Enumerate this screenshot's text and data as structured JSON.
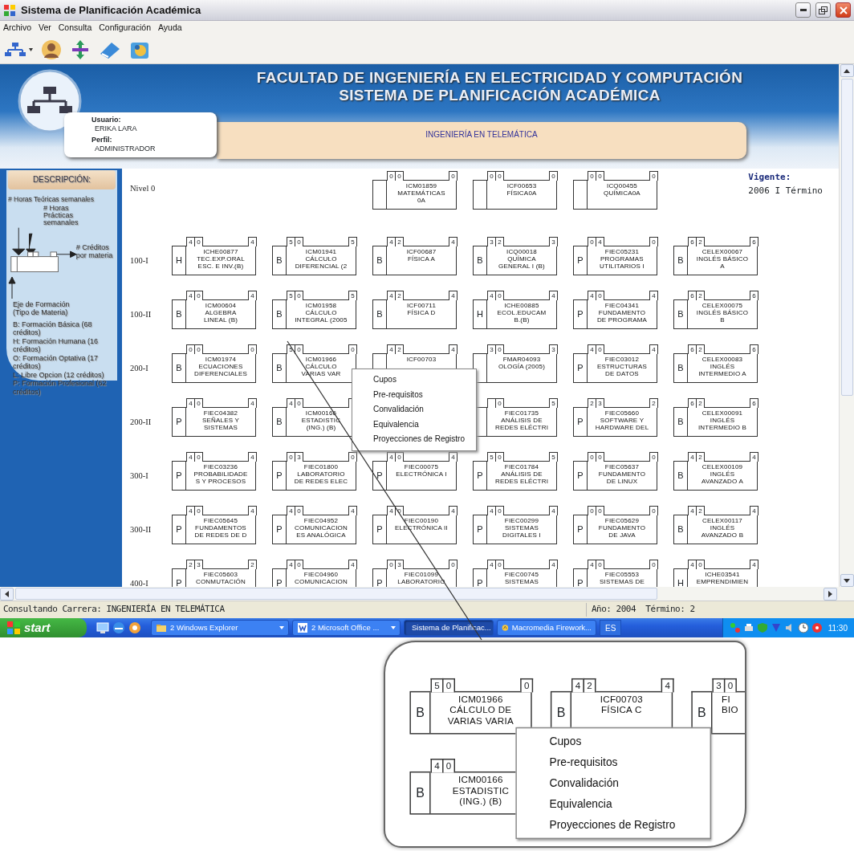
{
  "window": {
    "title": "Sistema de Planificación Académica"
  },
  "menu": [
    "Archivo",
    "Ver",
    "Consulta",
    "Configuración",
    "Ayuda"
  ],
  "header": {
    "faculty": "FACULTAD DE INGENIERÍA EN ELECTRICIDAD Y COMPUTACIÓN",
    "system": "SISTEMA DE PLANIFICACIÓN ACADÉMICA",
    "user_label": "Usuario:",
    "user": "ERIKA LARA",
    "profile_label": "Perfil:",
    "profile": "ADMINISTRADOR",
    "career": "INGENIERÍA EN TELEMÁTICA",
    "valid_label": "Vigente:",
    "valid": "2006 I Término"
  },
  "legend": {
    "title": "DESCRIPCIÓN:",
    "theory": "# Horas Teóricas semanales",
    "practice": "# Horas Prácticas semanales",
    "credits": "# Créditos por materia",
    "axis": "Eje de Formación (Tipo de Materia)",
    "types": [
      "B: Formación Básica (68 créditos)",
      "H: Formación Humana (16 créditos)",
      "O: Formación Optativa (17 créditos)",
      "L: Libre Opcion (12 créditos)",
      "P: Formación Profesional (62 créditos)"
    ]
  },
  "levels": [
    {
      "label": "Nivel 0",
      "courses": [
        {
          "kind": "blank"
        },
        {
          "kind": "blank"
        },
        {
          "kind": "course",
          "t": "0",
          "p": "0",
          "c": "0",
          "code": "ICM01859",
          "name": [
            "MATEMÁTICAS",
            "0A"
          ]
        },
        {
          "kind": "course",
          "t": "0",
          "p": "0",
          "c": "0",
          "code": "ICF00653",
          "name": [
            "FÍSICA0A"
          ]
        },
        {
          "kind": "course",
          "t": "0",
          "p": "0",
          "c": "0",
          "code": "ICQ00455",
          "name": [
            "QUÍMICA0A"
          ]
        }
      ]
    },
    {
      "label": "100-I",
      "courses": [
        {
          "kind": "course",
          "type": "H",
          "t": "4",
          "p": "0",
          "c": "4",
          "code": "ICHE00877",
          "name": [
            "TEC.EXP.ORAL",
            "ESC. E INV.(B)"
          ]
        },
        {
          "kind": "course",
          "type": "B",
          "t": "5",
          "p": "0",
          "c": "5",
          "code": "ICM01941",
          "name": [
            "CÁLCULO",
            "DIFERENCIAL (2"
          ]
        },
        {
          "kind": "course",
          "type": "B",
          "t": "4",
          "p": "2",
          "c": "4",
          "code": "ICF00687",
          "name": [
            "FÍSICA A"
          ]
        },
        {
          "kind": "course",
          "type": "B",
          "t": "3",
          "p": "2",
          "c": "3",
          "code": "ICQ00018",
          "name": [
            "QUÍMICA",
            "GENERAL I (B)"
          ]
        },
        {
          "kind": "course",
          "type": "P",
          "t": "0",
          "p": "4",
          "c": "0",
          "code": "FIEC05231",
          "name": [
            "PROGRAMAS",
            "UTILITARIOS I"
          ]
        },
        {
          "kind": "course",
          "type": "B",
          "t": "6",
          "p": "2",
          "c": "6",
          "code": "CELEX00067",
          "name": [
            "INGLÉS BÁSICO",
            "A"
          ]
        }
      ]
    },
    {
      "label": "100-II",
      "courses": [
        {
          "kind": "course",
          "type": "B",
          "t": "4",
          "p": "0",
          "c": "4",
          "code": "ICM00604",
          "name": [
            "ALGEBRA",
            "LINEAL (B)"
          ]
        },
        {
          "kind": "course",
          "type": "B",
          "t": "5",
          "p": "0",
          "c": "5",
          "code": "ICM01958",
          "name": [
            "CÁLCULO",
            "INTEGRAL (2005"
          ]
        },
        {
          "kind": "course",
          "type": "B",
          "t": "4",
          "p": "2",
          "c": "4",
          "code": "ICF00711",
          "name": [
            "FÍSICA D"
          ]
        },
        {
          "kind": "course",
          "type": "H",
          "t": "4",
          "p": "0",
          "c": "4",
          "code": "ICHE00885",
          "name": [
            "ECOL.EDUCAM",
            "B.(B)"
          ]
        },
        {
          "kind": "course",
          "type": "P",
          "t": "4",
          "p": "0",
          "c": "4",
          "code": "FIEC04341",
          "name": [
            "FUNDAMENTO",
            "DE PROGRAMA"
          ]
        },
        {
          "kind": "course",
          "type": "B",
          "t": "6",
          "p": "2",
          "c": "6",
          "code": "CELEX00075",
          "name": [
            "INGLÉS BÁSICO",
            "B"
          ]
        }
      ]
    },
    {
      "label": "200-I",
      "courses": [
        {
          "kind": "course",
          "type": "B",
          "t": "0",
          "p": "0",
          "c": "0",
          "code": "ICM01974",
          "name": [
            "ECUACIONES",
            "DIFERENCIALES"
          ]
        },
        {
          "kind": "course",
          "type": "B",
          "t": "5",
          "p": "0",
          "c": "0",
          "code": "ICM01966",
          "name": [
            "CÁLCULO",
            "VARIAS VAR"
          ]
        },
        {
          "kind": "course",
          "t": "4",
          "p": "2",
          "c": "4",
          "code": "ICF00703"
        },
        {
          "kind": "course",
          "t": "3",
          "p": "0",
          "c": "3",
          "code": "FMAR04093",
          "name": [
            "OLOGÍA (2005)"
          ]
        },
        {
          "kind": "course",
          "type": "P",
          "t": "4",
          "p": "0",
          "c": "4",
          "code": "FIEC03012",
          "name": [
            "ESTRUCTURAS",
            "DE DATOS"
          ]
        },
        {
          "kind": "course",
          "type": "B",
          "t": "6",
          "p": "2",
          "c": "6",
          "code": "CELEX00083",
          "name": [
            "INGLÉS",
            "INTERMEDIO A"
          ]
        }
      ]
    },
    {
      "label": "200-II",
      "courses": [
        {
          "kind": "course",
          "type": "P",
          "t": "4",
          "p": "0",
          "c": "4",
          "code": "FIEC04382",
          "name": [
            "SEÑALES Y",
            "SISTEMAS"
          ]
        },
        {
          "kind": "course",
          "type": "B",
          "t": "4",
          "p": "0",
          "code": "ICM00166",
          "name": [
            "ESTADISTIC",
            "(ING.) (B)"
          ]
        },
        {
          "kind": "blank"
        },
        {
          "kind": "course",
          "p": "0",
          "c": "5",
          "code": "FIEC01735",
          "name": [
            "ANÁLISIS DE",
            "REDES ELÉCTRI"
          ]
        },
        {
          "kind": "course",
          "type": "P",
          "t": "2",
          "p": "3",
          "c": "2",
          "code": "FIEC05660",
          "name": [
            "SOFTWARE Y",
            "HARDWARE DEL"
          ]
        },
        {
          "kind": "course",
          "type": "B",
          "t": "6",
          "p": "2",
          "c": "6",
          "code": "CELEX00091",
          "name": [
            "INGLÉS",
            "INTERMEDIO B"
          ]
        }
      ]
    },
    {
      "label": "300-I",
      "courses": [
        {
          "kind": "course",
          "type": "P",
          "t": "4",
          "p": "0",
          "c": "4",
          "code": "FIEC03236",
          "name": [
            "PROBABILIDADE",
            "S Y PROCESOS"
          ]
        },
        {
          "kind": "course",
          "type": "P",
          "t": "0",
          "p": "3",
          "c": "0",
          "code": "FIEC01800",
          "name": [
            "LABORATORIO",
            "DE REDES ELEC"
          ]
        },
        {
          "kind": "course",
          "type": "P",
          "t": "4",
          "p": "0",
          "c": "4",
          "code": "FIEC00075",
          "name": [
            "ELECTRÓNICA I"
          ]
        },
        {
          "kind": "course",
          "type": "P",
          "t": "5",
          "p": "0",
          "c": "5",
          "code": "FIEC01784",
          "name": [
            "ANÁLISIS DE",
            "REDES ELÉCTRI"
          ]
        },
        {
          "kind": "course",
          "type": "P",
          "t": "0",
          "p": "0",
          "c": "0",
          "code": "FIEC05637",
          "name": [
            "FUNDAMENTO",
            "DE LINUX"
          ]
        },
        {
          "kind": "course",
          "type": "B",
          "t": "4",
          "p": "2",
          "c": "4",
          "code": "CELEX00109",
          "name": [
            "INGLÉS",
            "AVANZADO A"
          ]
        }
      ]
    },
    {
      "label": "300-II",
      "courses": [
        {
          "kind": "course",
          "type": "P",
          "t": "4",
          "p": "0",
          "c": "4",
          "code": "FIEC05645",
          "name": [
            "FUNDAMENTOS",
            "DE REDES DE D"
          ]
        },
        {
          "kind": "course",
          "type": "P",
          "t": "4",
          "p": "0",
          "c": "4",
          "code": "FIEC04952",
          "name": [
            "COMUNICACION",
            "ES ANALÓGICA"
          ]
        },
        {
          "kind": "course",
          "type": "P",
          "t": "4",
          "p": "0",
          "c": "4",
          "code": "FIEC00190",
          "name": [
            "ELECTRÓNICA II"
          ]
        },
        {
          "kind": "course",
          "type": "P",
          "t": "4",
          "p": "0",
          "c": "4",
          "code": "FIEC00299",
          "name": [
            "SISTEMAS",
            "DIGITALES I"
          ]
        },
        {
          "kind": "course",
          "type": "P",
          "t": "0",
          "p": "0",
          "c": "0",
          "code": "FIEC05629",
          "name": [
            "FUNDAMENTO",
            "DE JAVA"
          ]
        },
        {
          "kind": "course",
          "type": "B",
          "t": "4",
          "p": "2",
          "c": "4",
          "code": "CELEX00117",
          "name": [
            "INGLÉS",
            "AVANZADO B"
          ]
        }
      ]
    },
    {
      "label": "400-I",
      "courses": [
        {
          "kind": "course",
          "type": "P",
          "t": "2",
          "p": "3",
          "c": "2",
          "code": "FIEC05603",
          "name": [
            "CONMUTACIÓN"
          ]
        },
        {
          "kind": "course",
          "type": "P",
          "t": "4",
          "p": "0",
          "c": "4",
          "code": "FIEC04960",
          "name": [
            "COMUNICACION"
          ]
        },
        {
          "kind": "course",
          "type": "P",
          "t": "0",
          "p": "3",
          "c": "0",
          "code": "FIEC01099",
          "name": [
            "LABORATORIO"
          ]
        },
        {
          "kind": "course",
          "type": "P",
          "t": "4",
          "p": "0",
          "c": "4",
          "code": "FIEC00745",
          "name": [
            "SISTEMAS"
          ]
        },
        {
          "kind": "course",
          "type": "P",
          "t": "4",
          "p": "0",
          "c": "0",
          "code": "FIEC05553",
          "name": [
            "SISTEMAS DE"
          ]
        },
        {
          "kind": "course",
          "type": "H",
          "t": "4",
          "p": "0",
          "c": "4",
          "code": "ICHE03541",
          "name": [
            "EMPRENDIMIEN"
          ]
        }
      ]
    }
  ],
  "context_menu": [
    "Cupos",
    "Pre-requisitos",
    "Convalidación",
    "Equivalencia",
    "Proyecciones de Registro"
  ],
  "status_bar": {
    "left": "Consultando Carrera: INGENIERÍA EN TELEMÁTICA",
    "right": "Año: 2004  Término: 2"
  },
  "taskbar": {
    "start": "start",
    "tasks": [
      {
        "label": "2 Windows Explorer",
        "grouped": true,
        "selected": false
      },
      {
        "label": "2 Microsoft Office ...",
        "grouped": true,
        "selected": false
      },
      {
        "label": "Sistema de Planificac...",
        "grouped": false,
        "selected": true
      },
      {
        "label": "Macromedia Firework...",
        "grouped": false,
        "selected": false
      }
    ],
    "language": "ES",
    "clock": "11:30"
  },
  "callout": {
    "courses": [
      {
        "type": "B",
        "t": "5",
        "p": "0",
        "c": "0",
        "code": "ICM01966",
        "name": [
          "CÁLCULO DE",
          "VARIAS VARIA"
        ],
        "cut": false
      },
      {
        "type": "B",
        "t": "4",
        "p": "2",
        "c": "4",
        "code": "ICF00703",
        "name": [
          "FÍSICA C"
        ],
        "cut": false
      },
      {
        "type": "B",
        "t": "3",
        "p": "0",
        "code": "FI",
        "name": [
          "BIO"
        ],
        "cut": true
      },
      {
        "type": "B",
        "t": "4",
        "p": "0",
        "code": "ICM00166",
        "name": [
          "ESTADISTIC",
          "(ING.) (B)"
        ],
        "cut": false
      }
    ],
    "menu": [
      "Cupos",
      "Pre-requisitos",
      "Convalidación",
      "Equivalencia",
      "Proyecciones de Registro"
    ]
  }
}
